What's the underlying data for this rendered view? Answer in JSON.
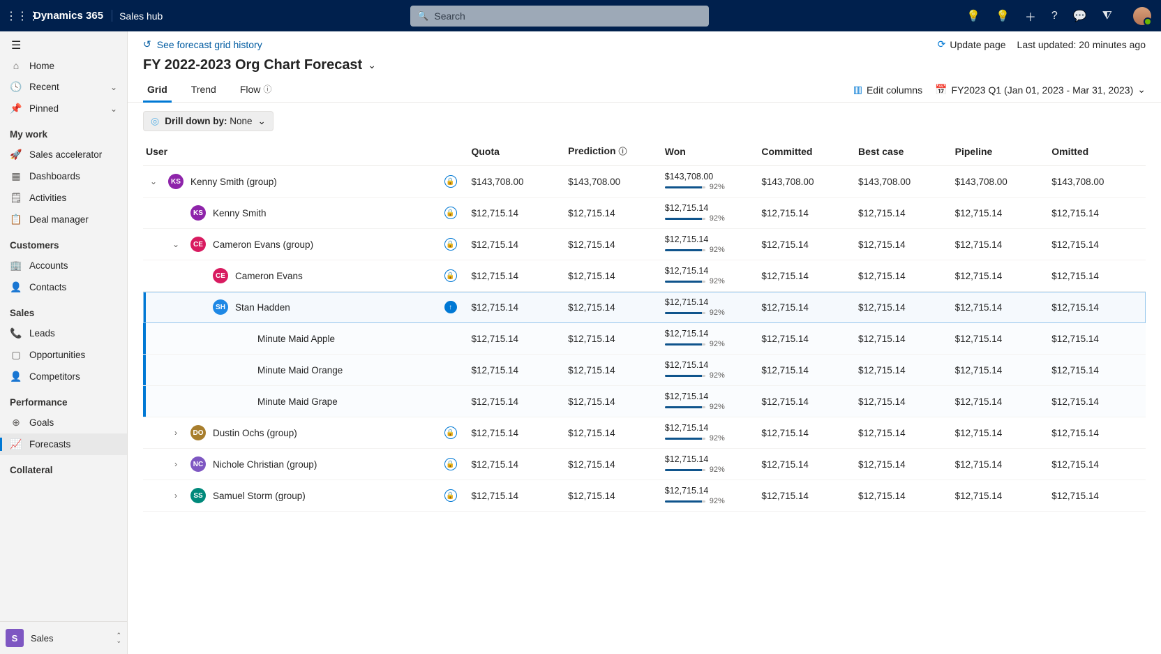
{
  "header": {
    "app_title": "Dynamics 365",
    "sub_title": "Sales hub",
    "search_placeholder": "Search"
  },
  "sidebar": {
    "home": "Home",
    "recent": "Recent",
    "pinned": "Pinned",
    "sections": [
      {
        "title": "My work",
        "items": [
          {
            "icon": "🚀",
            "label": "Sales accelerator"
          },
          {
            "icon": "▦",
            "label": "Dashboards"
          },
          {
            "icon": "🗒",
            "label": "Activities"
          },
          {
            "icon": "📋",
            "label": "Deal manager"
          }
        ]
      },
      {
        "title": "Customers",
        "items": [
          {
            "icon": "🏢",
            "label": "Accounts"
          },
          {
            "icon": "👤",
            "label": "Contacts"
          }
        ]
      },
      {
        "title": "Sales",
        "items": [
          {
            "icon": "📞",
            "label": "Leads"
          },
          {
            "icon": "▢",
            "label": "Opportunities"
          },
          {
            "icon": "👤",
            "label": "Competitors"
          }
        ]
      },
      {
        "title": "Performance",
        "items": [
          {
            "icon": "⊕",
            "label": "Goals"
          },
          {
            "icon": "📈",
            "label": "Forecasts",
            "active": true
          }
        ]
      },
      {
        "title": "Collateral",
        "items": []
      }
    ],
    "footer": {
      "badge": "S",
      "label": "Sales"
    }
  },
  "toolbar": {
    "history": "See forecast grid history",
    "update": "Update page",
    "last_updated": "Last updated: 20 minutes ago"
  },
  "page_title": "FY 2022-2023 Org Chart Forecast",
  "tabs": {
    "grid": "Grid",
    "trend": "Trend",
    "flow": "Flow"
  },
  "actions": {
    "edit_columns": "Edit columns",
    "period": "FY2023 Q1 (Jan 01, 2023 - Mar 31, 2023)"
  },
  "drilldown": {
    "label": "Drill down by:",
    "value": "None"
  },
  "columns": [
    "User",
    "Quota",
    "Prediction",
    "Won",
    "Committed",
    "Best case",
    "Pipeline",
    "Omitted"
  ],
  "rows": [
    {
      "indent": 0,
      "exp": "down",
      "avatar": "KS",
      "color": "c-purple",
      "name": "Kenny Smith (group)",
      "lock": "open",
      "quota": "$143,708.00",
      "prediction": "$143,708.00",
      "won": "$143,708.00",
      "pct": "92%",
      "committed": "$143,708.00",
      "best": "$143,708.00",
      "pipeline": "$143,708.00",
      "omitted": "$143,708.00"
    },
    {
      "indent": 1,
      "exp": "",
      "avatar": "KS",
      "color": "c-purple",
      "name": "Kenny Smith",
      "lock": "open",
      "quota": "$12,715.14",
      "prediction": "$12,715.14",
      "won": "$12,715.14",
      "pct": "92%",
      "committed": "$12,715.14",
      "best": "$12,715.14",
      "pipeline": "$12,715.14",
      "omitted": "$12,715.14"
    },
    {
      "indent": 1,
      "exp": "down",
      "avatar": "CE",
      "color": "c-magenta",
      "name": "Cameron Evans (group)",
      "lock": "open",
      "quota": "$12,715.14",
      "prediction": "$12,715.14",
      "won": "$12,715.14",
      "pct": "92%",
      "committed": "$12,715.14",
      "best": "$12,715.14",
      "pipeline": "$12,715.14",
      "omitted": "$12,715.14"
    },
    {
      "indent": 2,
      "exp": "",
      "avatar": "CE",
      "color": "c-magenta",
      "name": "Cameron Evans",
      "lock": "open",
      "quota": "$12,715.14",
      "prediction": "$12,715.14",
      "won": "$12,715.14",
      "pct": "92%",
      "committed": "$12,715.14",
      "best": "$12,715.14",
      "pipeline": "$12,715.14",
      "omitted": "$12,715.14"
    },
    {
      "indent": 2,
      "exp": "",
      "avatar": "SH",
      "color": "c-blue",
      "name": "Stan Hadden",
      "lock": "fill",
      "quota": "$12,715.14",
      "prediction": "$12,715.14",
      "won": "$12,715.14",
      "pct": "92%",
      "committed": "$12,715.14",
      "best": "$12,715.14",
      "pipeline": "$12,715.14",
      "omitted": "$12,715.14",
      "selected": true
    },
    {
      "indent": 3,
      "exp": "",
      "avatar": "",
      "color": "",
      "name": "Minute Maid Apple",
      "lock": "",
      "quota": "$12,715.14",
      "prediction": "$12,715.14",
      "won": "$12,715.14",
      "pct": "92%",
      "committed": "$12,715.14",
      "best": "$12,715.14",
      "pipeline": "$12,715.14",
      "omitted": "$12,715.14",
      "childsel": true
    },
    {
      "indent": 3,
      "exp": "",
      "avatar": "",
      "color": "",
      "name": "Minute Maid Orange",
      "lock": "",
      "quota": "$12,715.14",
      "prediction": "$12,715.14",
      "won": "$12,715.14",
      "pct": "92%",
      "committed": "$12,715.14",
      "best": "$12,715.14",
      "pipeline": "$12,715.14",
      "omitted": "$12,715.14",
      "childsel": true
    },
    {
      "indent": 3,
      "exp": "",
      "avatar": "",
      "color": "",
      "name": "Minute Maid Grape",
      "lock": "",
      "quota": "$12,715.14",
      "prediction": "$12,715.14",
      "won": "$12,715.14",
      "pct": "92%",
      "committed": "$12,715.14",
      "best": "$12,715.14",
      "pipeline": "$12,715.14",
      "omitted": "$12,715.14",
      "childsel": true
    },
    {
      "indent": 1,
      "exp": "right",
      "avatar": "DO",
      "color": "c-olive",
      "name": "Dustin Ochs (group)",
      "lock": "open",
      "quota": "$12,715.14",
      "prediction": "$12,715.14",
      "won": "$12,715.14",
      "pct": "92%",
      "committed": "$12,715.14",
      "best": "$12,715.14",
      "pipeline": "$12,715.14",
      "omitted": "$12,715.14"
    },
    {
      "indent": 1,
      "exp": "right",
      "avatar": "NC",
      "color": "c-violet",
      "name": "Nichole Christian (group)",
      "lock": "open",
      "quota": "$12,715.14",
      "prediction": "$12,715.14",
      "won": "$12,715.14",
      "pct": "92%",
      "committed": "$12,715.14",
      "best": "$12,715.14",
      "pipeline": "$12,715.14",
      "omitted": "$12,715.14"
    },
    {
      "indent": 1,
      "exp": "right",
      "avatar": "SS",
      "color": "c-teal",
      "name": "Samuel Storm (group)",
      "lock": "open",
      "quota": "$12,715.14",
      "prediction": "$12,715.14",
      "won": "$12,715.14",
      "pct": "92%",
      "committed": "$12,715.14",
      "best": "$12,715.14",
      "pipeline": "$12,715.14",
      "omitted": "$12,715.14"
    }
  ]
}
